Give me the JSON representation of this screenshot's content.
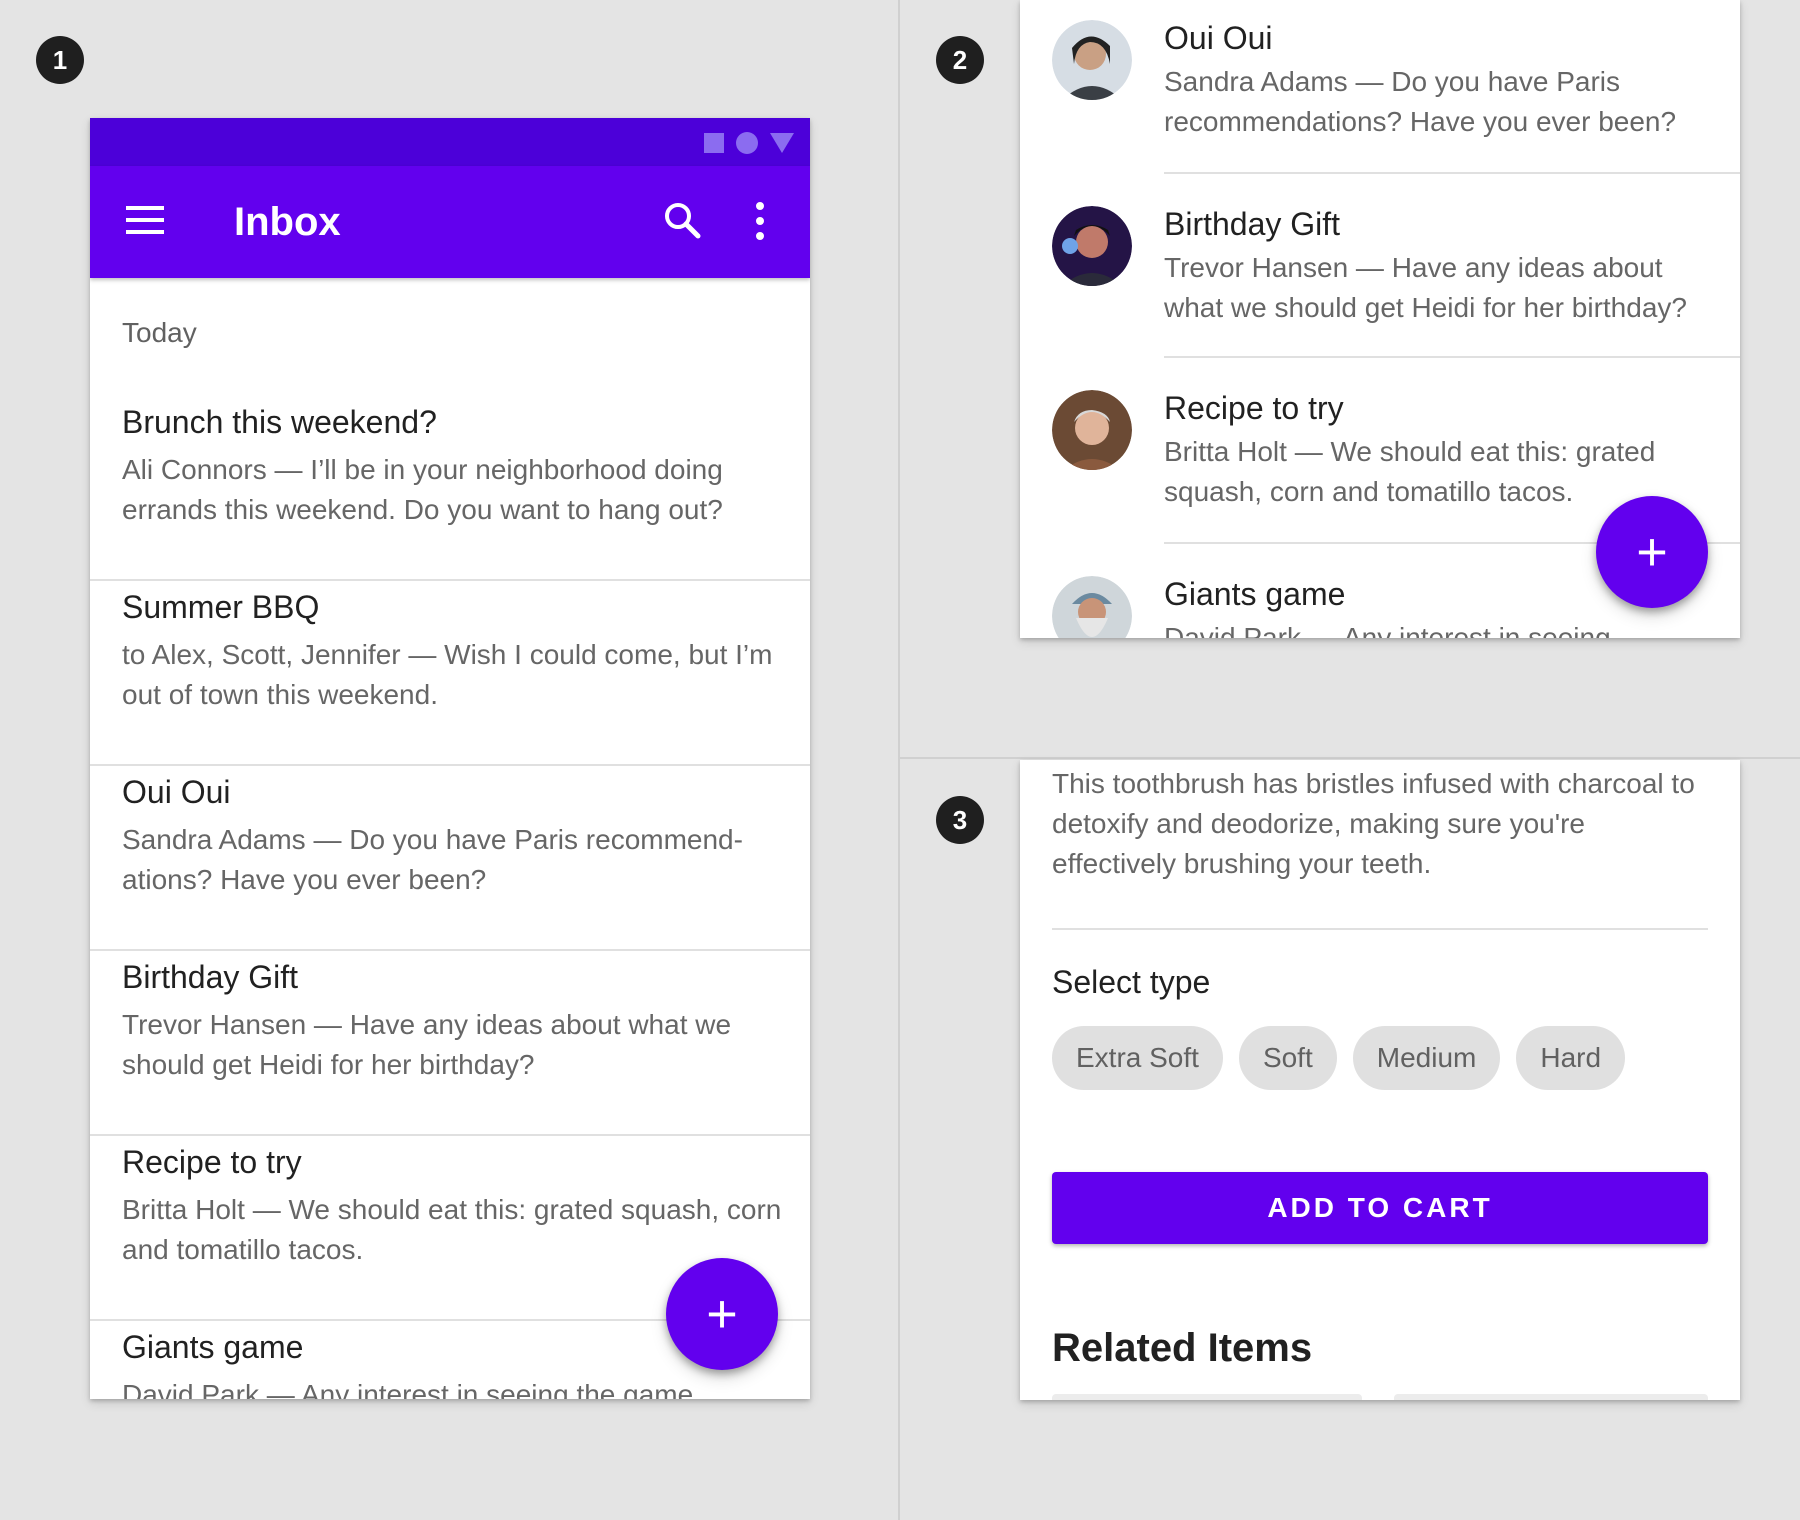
{
  "steps": [
    "1",
    "2",
    "3"
  ],
  "colors": {
    "primary": "#6200ee",
    "status_bar": "#4c00d9",
    "canvas": "#e4e4e4"
  },
  "panel1": {
    "app_title": "Inbox",
    "icons": {
      "menu": "menu-icon",
      "search": "search-icon",
      "more": "more-vert-icon"
    },
    "subheader": "Today",
    "items": [
      {
        "title": "Brunch this weekend?",
        "body": "Ali Connors — I’ll be in your neighborhood doing errands this weekend. Do you want to hang out?"
      },
      {
        "title": "Summer BBQ",
        "body": "to Alex, Scott, Jennifer — Wish I could come, but I’m out of town this weekend."
      },
      {
        "title": "Oui Oui",
        "body": "Sandra Adams — Do you have Paris recommend-ations? Have you ever been?"
      },
      {
        "title": "Birthday Gift",
        "body": "Trevor Hansen — Have any ideas about what we should get Heidi for her birthday?"
      },
      {
        "title": "Recipe to try",
        "body": "Britta Holt — We should eat this: grated squash, corn and tomatillo tacos."
      },
      {
        "title": "Giants game",
        "body": "David Park — Any interest in seeing the game"
      }
    ],
    "fab_label": "+"
  },
  "panel2": {
    "items": [
      {
        "title": "Oui Oui",
        "body": "Sandra Adams — Do you have Paris recommendations? Have you ever been?"
      },
      {
        "title": "Birthday Gift",
        "body": "Trevor Hansen — Have any ideas about what we should get Heidi for her birthday?"
      },
      {
        "title": "Recipe to try",
        "body": "Britta Holt — We should eat this: grated squash, corn and tomatillo tacos."
      },
      {
        "title": "Giants game",
        "body": "David Park — Any interest in seeing"
      }
    ],
    "fab_label": "+"
  },
  "panel3": {
    "description": "This toothbrush has bristles infused with charcoal to detoxify and deodorize, making sure you're effectively brushing your teeth.",
    "select_label": "Select type",
    "chips": [
      "Extra Soft",
      "Soft",
      "Medium",
      "Hard"
    ],
    "cta": "ADD TO CART",
    "related_title": "Related Items"
  }
}
